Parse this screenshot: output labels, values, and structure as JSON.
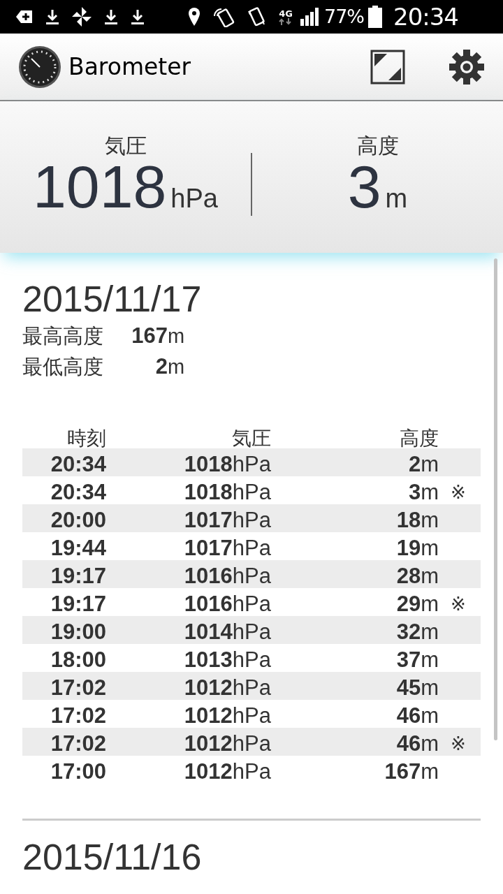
{
  "status_bar": {
    "battery": "77%",
    "time": "20:34",
    "network": "4G"
  },
  "app_bar": {
    "title": "Barometer"
  },
  "readout": [
    {
      "label": "気圧",
      "value": "1018",
      "unit": "hPa"
    },
    {
      "label": "高度",
      "value": "3",
      "unit": "m"
    }
  ],
  "days": [
    {
      "date": "2015/11/17",
      "stats": [
        {
          "label": "最高高度",
          "value": "167",
          "unit": "m"
        },
        {
          "label": "最低高度",
          "value": "2",
          "unit": "m"
        }
      ],
      "columns": [
        "時刻",
        "気圧",
        "高度"
      ],
      "rows": [
        {
          "time": "20:34",
          "pressure": "1018",
          "pressure_unit": "hPa",
          "altitude": "2",
          "altitude_unit": "m"
        },
        {
          "time": "20:34",
          "pressure": "1018",
          "pressure_unit": "hPa",
          "altitude": "3",
          "altitude_unit": "m",
          "note": "※"
        },
        {
          "time": "20:00",
          "pressure": "1017",
          "pressure_unit": "hPa",
          "altitude": "18",
          "altitude_unit": "m"
        },
        {
          "time": "19:44",
          "pressure": "1017",
          "pressure_unit": "hPa",
          "altitude": "19",
          "altitude_unit": "m"
        },
        {
          "time": "19:17",
          "pressure": "1016",
          "pressure_unit": "hPa",
          "altitude": "28",
          "altitude_unit": "m"
        },
        {
          "time": "19:17",
          "pressure": "1016",
          "pressure_unit": "hPa",
          "altitude": "29",
          "altitude_unit": "m",
          "note": "※"
        },
        {
          "time": "19:00",
          "pressure": "1014",
          "pressure_unit": "hPa",
          "altitude": "32",
          "altitude_unit": "m"
        },
        {
          "time": "18:00",
          "pressure": "1013",
          "pressure_unit": "hPa",
          "altitude": "37",
          "altitude_unit": "m"
        },
        {
          "time": "17:02",
          "pressure": "1012",
          "pressure_unit": "hPa",
          "altitude": "45",
          "altitude_unit": "m"
        },
        {
          "time": "17:02",
          "pressure": "1012",
          "pressure_unit": "hPa",
          "altitude": "46",
          "altitude_unit": "m"
        },
        {
          "time": "17:02",
          "pressure": "1012",
          "pressure_unit": "hPa",
          "altitude": "46",
          "altitude_unit": "m",
          "note": "※"
        },
        {
          "time": "17:00",
          "pressure": "1012",
          "pressure_unit": "hPa",
          "altitude": "167",
          "altitude_unit": "m"
        }
      ]
    },
    {
      "date": "2015/11/16"
    }
  ]
}
